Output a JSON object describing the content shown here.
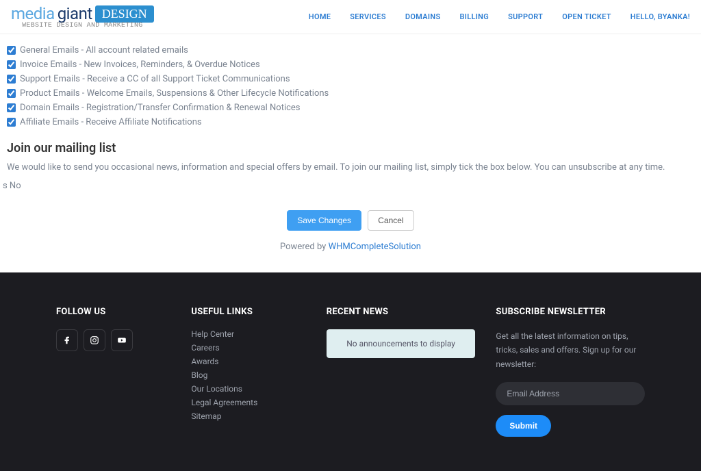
{
  "header": {
    "logo_part1": "media",
    "logo_part2": "giant",
    "logo_badge": "DESIGN",
    "tagline": "WEBSITE DESIGN AND MARKETING",
    "nav": [
      "HOME",
      "SERVICES",
      "DOMAINS",
      "BILLING",
      "SUPPORT",
      "OPEN TICKET",
      "HELLO, BYANKA!"
    ]
  },
  "prefs": [
    "General Emails - All account related emails",
    "Invoice Emails - New Invoices, Reminders, & Overdue Notices",
    "Support Emails - Receive a CC of all Support Ticket Communications",
    "Product Emails - Welcome Emails, Suspensions & Other Lifecycle Notifications",
    "Domain Emails - Registration/Transfer Confirmation & Renewal Notices",
    "Affiliate Emails - Receive Affiliate Notifications"
  ],
  "mailing": {
    "title": "Join our mailing list",
    "desc": "We would like to send you occasional news, information and special offers by email. To join our mailing list, simply tick the box below. You can unsubscribe at any time.",
    "yesno": "s No"
  },
  "buttons": {
    "save": "Save Changes",
    "cancel": "Cancel"
  },
  "powered": {
    "prefix": "Powered by ",
    "link": "WHMCompleteSolution"
  },
  "footer": {
    "follow_title": "FOLLOW US",
    "useful_title": "USEFUL LINKS",
    "useful_links": [
      "Help Center",
      "Careers",
      "Awards",
      "Blog",
      "Our Locations",
      "Legal Agreements",
      "Sitemap"
    ],
    "news_title": "RECENT NEWS",
    "news_empty": "No announcements to display",
    "sub_title": "SUBSCRIBE NEWSLETTER",
    "sub_desc": "Get all the latest information on tips, tricks, sales and offers. Sign up for our newsletter:",
    "email_placeholder": "Email Address",
    "submit": "Submit"
  }
}
